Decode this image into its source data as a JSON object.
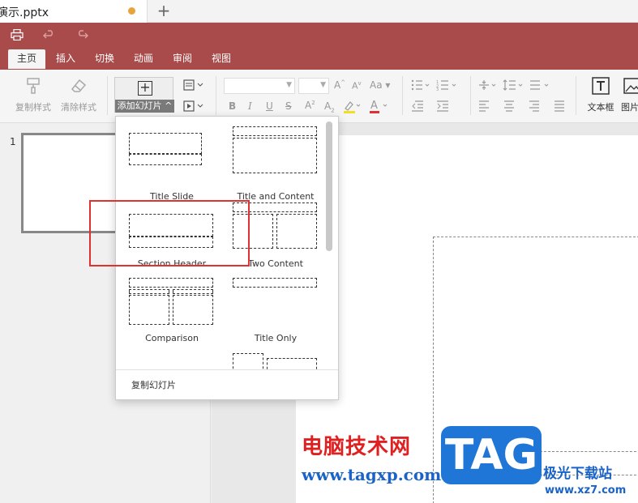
{
  "document": {
    "title": "演示.pptx",
    "unsaved_color": "#e8a33d"
  },
  "theme": {
    "accent": "#a94b4b",
    "active_tab_bg": "#f5f5f5"
  },
  "quick_access": {
    "print_icon": "printer-icon",
    "undo_icon": "undo-icon",
    "redo_icon": "redo-icon"
  },
  "menu": {
    "tabs": [
      "主页",
      "插入",
      "切换",
      "动画",
      "审阅",
      "视图"
    ],
    "active_index": 0
  },
  "ribbon": {
    "copy_format": "复制样式",
    "clear_format": "清除样式",
    "add_slide": "添加幻灯片",
    "text_box": "文本框",
    "picture": "图片"
  },
  "thumbnails": [
    {
      "number": "1"
    }
  ],
  "add_slide_menu": {
    "layouts": [
      "Title Slide",
      "Title and Content",
      "Section Header",
      "Two Content",
      "Comparison",
      "Title Only"
    ],
    "duplicate_label": "复制幻灯片"
  },
  "watermark": {
    "cn": "电脑技术网",
    "url": "www.tagxp.com",
    "tag": "TAG",
    "site_cn": "极光下载站",
    "site_url": "www.xz7.com"
  }
}
